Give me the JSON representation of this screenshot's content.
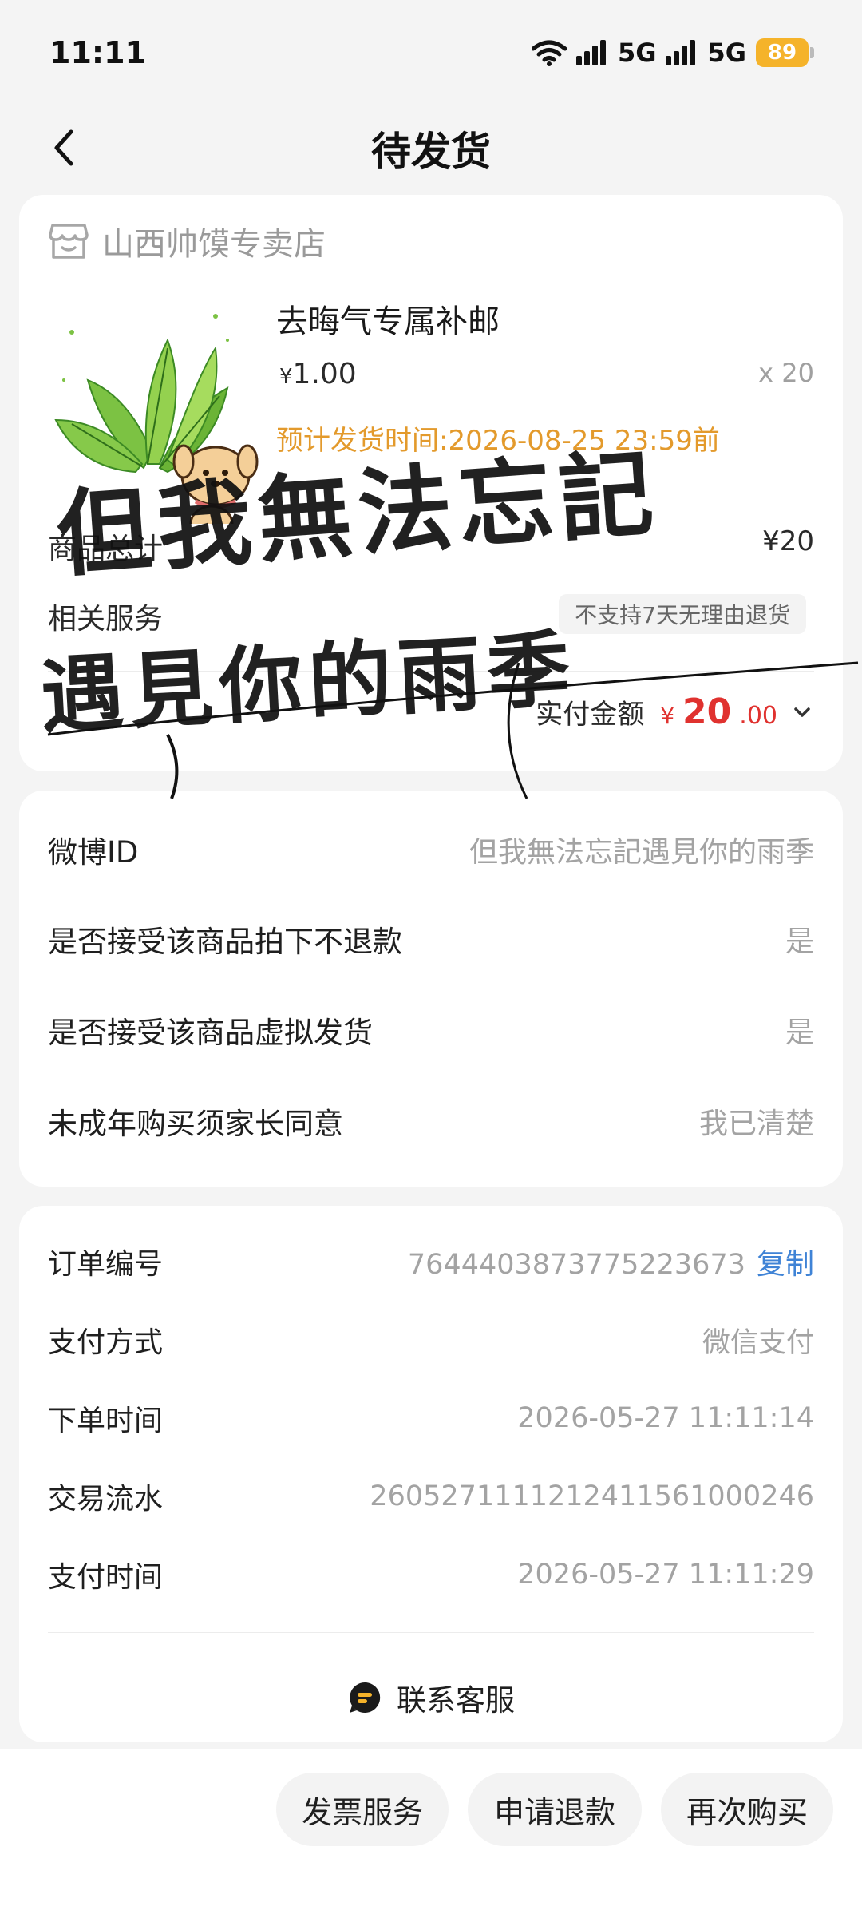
{
  "status_bar": {
    "time": "11:11",
    "net1": "5G",
    "net2": "5G",
    "battery": "89"
  },
  "nav": {
    "title": "待发货"
  },
  "product_card": {
    "shop_name": "山西帅馍专卖店",
    "product_title": "去晦气专属补邮",
    "price_symbol": "¥",
    "price": "1.00",
    "quantity": "x 20",
    "ship_time": "预计发货时间:2026-08-25 23:59前",
    "total_label": "商品总计",
    "total_value": "¥20",
    "service_label": "相关服务",
    "service_tag": "不支持7天无理由退货",
    "paid_label": "实付金额",
    "paid_symbol": "¥",
    "paid_int": "20",
    "paid_dec": ".00"
  },
  "info_card": {
    "rows": [
      {
        "label": "微博ID",
        "value": "但我無法忘記遇見你的雨季"
      },
      {
        "label": "是否接受该商品拍下不退款",
        "value": "是"
      },
      {
        "label": "是否接受该商品虚拟发货",
        "value": "是"
      },
      {
        "label": "未成年购买须家长同意",
        "value": "我已清楚"
      }
    ]
  },
  "order_card": {
    "order_no_label": "订单编号",
    "order_no": "7644403873775223673",
    "copy_label": "复制",
    "pay_method_label": "支付方式",
    "pay_method": "微信支付",
    "order_time_label": "下单时间",
    "order_time": "2026-05-27 11:11:14",
    "txn_label": "交易流水",
    "txn": "260527111121241156100024​6",
    "pay_time_label": "支付时间",
    "pay_time": "2026-05-27 11:11:29",
    "customer_service": "联系客服"
  },
  "bottom_bar": {
    "invoice": "发票服务",
    "refund": "申请退款",
    "rebuy": "再次购买"
  },
  "overlay": {
    "line1": "但我無法忘記",
    "line2": "遇見你的雨季"
  },
  "colors": {
    "accent_orange": "#e39a2c",
    "price_red": "#e0322f",
    "link_blue": "#3f83d6",
    "battery": "#f5b32a"
  }
}
